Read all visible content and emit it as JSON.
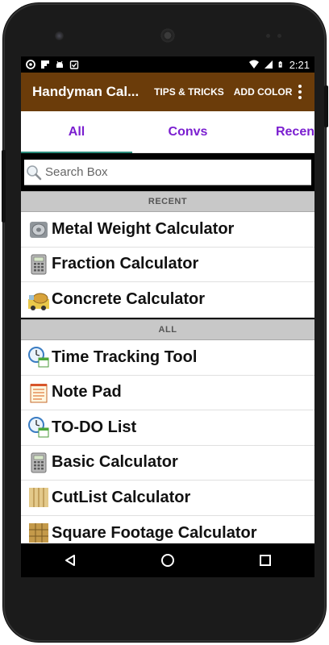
{
  "status_bar": {
    "time": "2:21",
    "left_icons": [
      "chrome-icon",
      "flipboard-icon",
      "android-icon",
      "clipboard-check-icon"
    ],
    "right_icons": [
      "wifi-icon",
      "signal-icon",
      "battery-charging-icon"
    ]
  },
  "app_bar": {
    "title": "Handyman Cal...",
    "actions": [
      "TIPS & TRICKS",
      "ADD COLOR"
    ],
    "overflow_icon": "overflow-menu-icon",
    "color": "#6b3c0a"
  },
  "tabs": [
    {
      "label": "All",
      "active": true
    },
    {
      "label": "Convs",
      "active": false
    },
    {
      "label": "Recen",
      "active": false
    }
  ],
  "tab_color": "#7b1fd0",
  "search": {
    "placeholder": "Search Box",
    "icon": "search-icon"
  },
  "sections": [
    {
      "header": "RECENT",
      "items": [
        {
          "label": "Metal Weight Calculator",
          "icon": "metal-roll-icon"
        },
        {
          "label": "Fraction Calculator",
          "icon": "calculator-icon"
        },
        {
          "label": "Concrete Calculator",
          "icon": "concrete-mixer-icon"
        }
      ]
    },
    {
      "header": "ALL",
      "items": [
        {
          "label": "Time Tracking Tool",
          "icon": "clock-calendar-icon"
        },
        {
          "label": "Note Pad",
          "icon": "notepad-icon"
        },
        {
          "label": "TO-DO List",
          "icon": "clock-calendar-icon"
        },
        {
          "label": "Basic Calculator",
          "icon": "calculator-icon"
        },
        {
          "label": "CutList Calculator",
          "icon": "wood-planks-icon"
        },
        {
          "label": "Square Footage Calculator",
          "icon": "floor-tiles-icon"
        }
      ]
    }
  ],
  "nav_bar": [
    "back-icon",
    "home-icon",
    "recents-icon"
  ]
}
